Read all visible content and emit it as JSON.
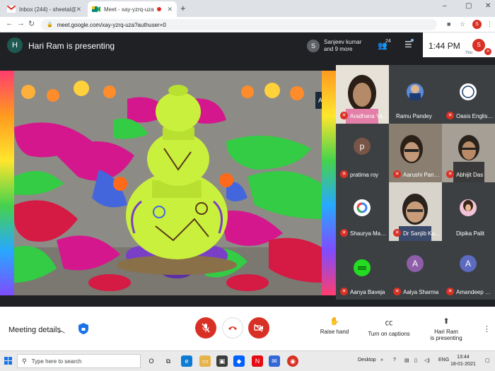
{
  "browser": {
    "tabs": [
      {
        "title": "Inbox (244) - sheetal@theindian",
        "active": false
      },
      {
        "title": "Meet - xay-yzrq-uza",
        "active": true
      }
    ],
    "new_tab": "+",
    "url": "meet.google.com/xay-yzrq-uza?authuser=0",
    "profile_initial": "S",
    "window_controls": [
      "–",
      "▢",
      "✕"
    ]
  },
  "meet": {
    "presenter_initial": "H",
    "presenting_title": "Hari Ram is presenting",
    "joined_avatar": "S",
    "joined_line1": "Sanjeev kumar",
    "joined_line2": "and 9 more",
    "people_count": "24",
    "clock": "1:44 PM",
    "you_initial": "S",
    "you_label": "You"
  },
  "participants": [
    {
      "name": "Aradhana Ya...",
      "muted": true,
      "kind": "video",
      "color": "#6b5a48"
    },
    {
      "name": "Ramu Pandey",
      "muted": false,
      "kind": "avatar",
      "color": "#3c4043"
    },
    {
      "name": "Oasis English...",
      "muted": true,
      "kind": "logo",
      "color": "#3c4043"
    },
    {
      "name": "pratima roy",
      "muted": true,
      "kind": "initial",
      "initial": "p",
      "color": "#795548"
    },
    {
      "name": "Aarushi Panw...",
      "muted": true,
      "kind": "video",
      "color": "#5b5148"
    },
    {
      "name": "Abhijit Das",
      "muted": true,
      "kind": "video",
      "color": "#6e6a62"
    },
    {
      "name": "Shaurya Mad...",
      "muted": true,
      "kind": "google",
      "color": "#3c4043"
    },
    {
      "name": "Dr Sanjib Ku...",
      "muted": true,
      "kind": "video",
      "color": "#7d7a74"
    },
    {
      "name": "Dipika Palit",
      "muted": false,
      "kind": "avatar2",
      "color": "#3c4043"
    },
    {
      "name": "Aanya Baveja",
      "muted": true,
      "kind": "green",
      "color": "#3c4043"
    },
    {
      "name": "Aalya Sharma",
      "muted": true,
      "kind": "initial",
      "initial": "A",
      "color": "#8e5fa8"
    },
    {
      "name": "Amandeep Si...",
      "muted": true,
      "kind": "initial",
      "initial": "A",
      "color": "#5c6bc0"
    }
  ],
  "controls": {
    "meeting_details": "Meeting details",
    "raise_hand": "Raise hand",
    "captions": "Turn on captions",
    "presenting_line1": "Hari Ram",
    "presenting_line2": "is presenting"
  },
  "taskbar": {
    "search_placeholder": "Type here to search",
    "desktop": "Desktop",
    "lang": "ENG",
    "time": "13:44",
    "date": "18-01-2021"
  }
}
